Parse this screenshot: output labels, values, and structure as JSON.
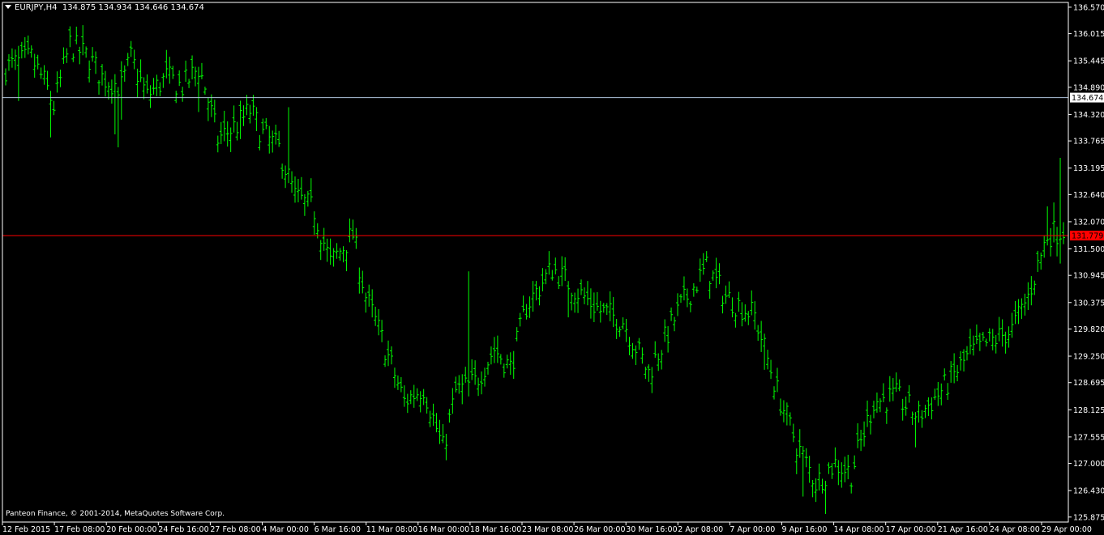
{
  "header": {
    "symbol_timeframe": "EURJPY,H4",
    "ohlc": "134.875 134.934 134.646 134.674"
  },
  "copyright": "Panteon Finance, © 2001-2014, MetaQuotes Software Corp.",
  "colors": {
    "background": "#000000",
    "bars": "#00FF00",
    "axis": "#FFFFFF",
    "bid_line": "#B0C4DE",
    "ask_line": "#FF0000",
    "ask_label_bg": "#FF0000"
  },
  "chart_data": {
    "type": "bar",
    "title": "",
    "symbol": "EURJPY",
    "timeframe": "H4",
    "ylim": [
      125.77,
      136.67
    ],
    "y_ticks": [
      "136.570",
      "136.015",
      "135.445",
      "134.890",
      "134.320",
      "133.765",
      "133.195",
      "132.640",
      "132.070",
      "131.500",
      "130.945",
      "130.375",
      "129.820",
      "129.250",
      "128.695",
      "128.125",
      "127.555",
      "127.000",
      "126.430",
      "125.875"
    ],
    "x_ticks": [
      "12 Feb 2015",
      "17 Feb 08:00",
      "20 Feb 00:00",
      "24 Feb 16:00",
      "27 Feb 08:00",
      "4 Mar 00:00",
      "6 Mar 16:00",
      "11 Mar 08:00",
      "16 Mar 00:00",
      "18 Mar 16:00",
      "23 Mar 08:00",
      "26 Mar 00:00",
      "30 Mar 16:00",
      "2 Apr 08:00",
      "7 Apr 00:00",
      "9 Apr 16:00",
      "14 Apr 08:00",
      "17 Apr 00:00",
      "21 Apr 16:00",
      "24 Apr 08:00",
      "29 Apr 00:00"
    ],
    "bid_line": {
      "value": 134.674,
      "label": "134.674"
    },
    "ask_line": {
      "value": 131.779,
      "label": "131.779"
    },
    "bar_count": 330,
    "path_anchors": [
      [
        0,
        135.3
      ],
      [
        8,
        135.5
      ],
      [
        12,
        135.0
      ],
      [
        15,
        134.5
      ],
      [
        20,
        135.8
      ],
      [
        26,
        135.5
      ],
      [
        30,
        135.1
      ],
      [
        36,
        134.9
      ],
      [
        39,
        135.5
      ],
      [
        44,
        134.7
      ],
      [
        50,
        135.1
      ],
      [
        55,
        134.9
      ],
      [
        60,
        135.3
      ],
      [
        62,
        134.9
      ],
      [
        66,
        133.8
      ],
      [
        72,
        134.1
      ],
      [
        76,
        134.4
      ],
      [
        80,
        133.9
      ],
      [
        85,
        133.6
      ],
      [
        90,
        132.6
      ],
      [
        96,
        132.3
      ],
      [
        101,
        131.2
      ],
      [
        108,
        131.8
      ],
      [
        112,
        130.5
      ],
      [
        116,
        129.8
      ],
      [
        124,
        128.3
      ],
      [
        130,
        128.6
      ],
      [
        136,
        127.3
      ],
      [
        140,
        128.5
      ],
      [
        146,
        128.7
      ],
      [
        152,
        129.4
      ],
      [
        157,
        129.0
      ],
      [
        162,
        130.3
      ],
      [
        170,
        131.1
      ],
      [
        178,
        130.6
      ],
      [
        185,
        130.2
      ],
      [
        192,
        130.0
      ],
      [
        200,
        128.9
      ],
      [
        210,
        130.3
      ],
      [
        218,
        131.1
      ],
      [
        224,
        130.5
      ],
      [
        233,
        130.1
      ],
      [
        240,
        128.5
      ],
      [
        246,
        127.4
      ],
      [
        252,
        126.6
      ],
      [
        258,
        127.0
      ],
      [
        263,
        126.8
      ],
      [
        270,
        128.3
      ],
      [
        277,
        128.4
      ],
      [
        284,
        128.0
      ],
      [
        292,
        128.6
      ],
      [
        300,
        129.3
      ],
      [
        305,
        129.5
      ],
      [
        313,
        129.8
      ],
      [
        318,
        130.5
      ],
      [
        324,
        131.8
      ],
      [
        329,
        131.9
      ]
    ],
    "spike_bars": [
      [
        4,
        0.25,
        0.75
      ],
      [
        14,
        0.2,
        0.7
      ],
      [
        34,
        0.2,
        0.9
      ],
      [
        35,
        0.1,
        1.1
      ],
      [
        36,
        0.2,
        0.9
      ],
      [
        60,
        0.2,
        0.6
      ],
      [
        73,
        0.1,
        0.6
      ],
      [
        88,
        1.3,
        0.2
      ],
      [
        144,
        2.3,
        0.3
      ],
      [
        175,
        0.1,
        0.6
      ],
      [
        236,
        0.1,
        0.5
      ],
      [
        248,
        0.1,
        0.9
      ],
      [
        255,
        0.1,
        0.5
      ],
      [
        283,
        0.1,
        0.6
      ],
      [
        324,
        0.7,
        0.1
      ],
      [
        326,
        0.4,
        0.4
      ],
      [
        328,
        1.7,
        0.5
      ]
    ]
  }
}
